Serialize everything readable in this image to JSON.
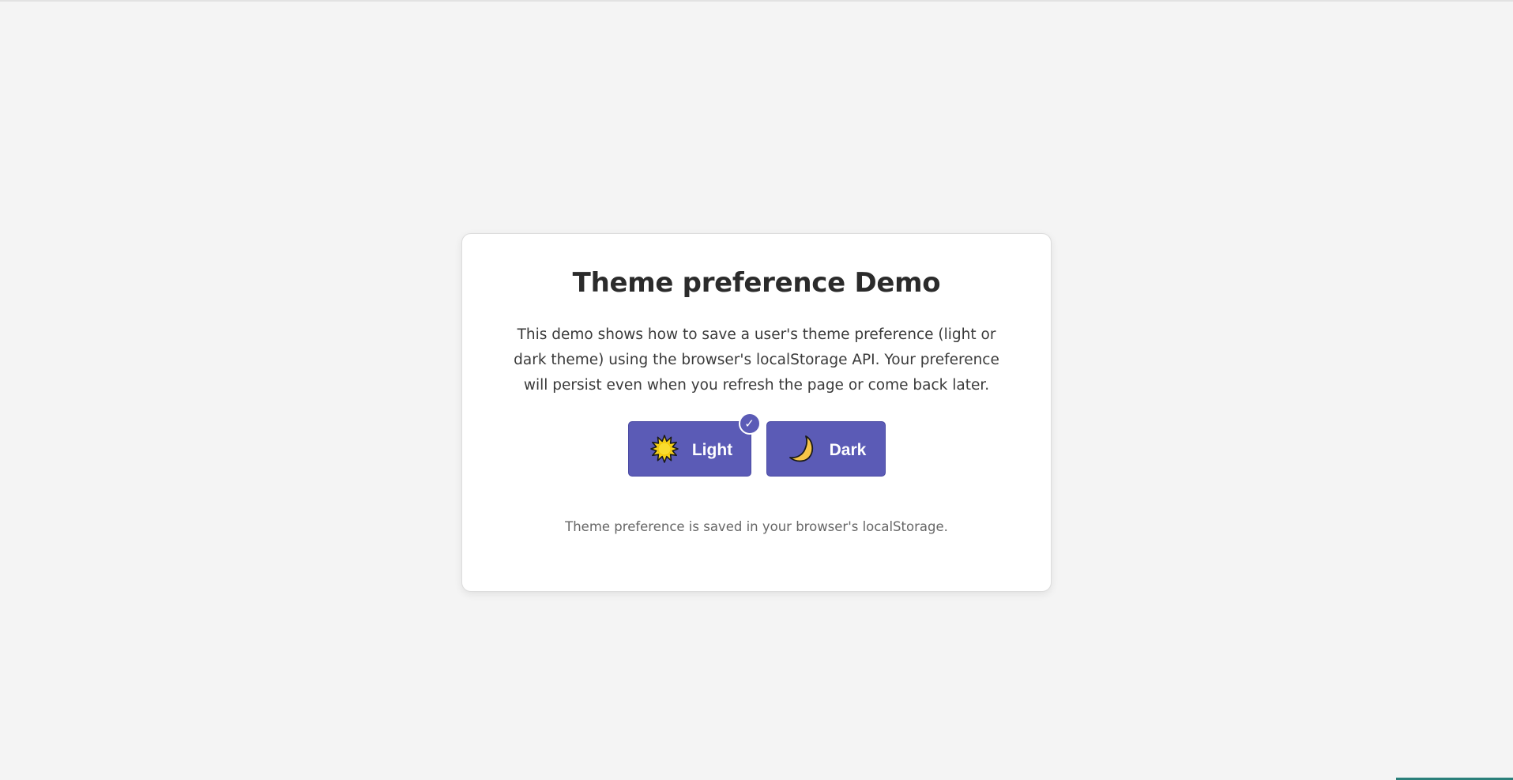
{
  "page": {
    "title": "Theme preference Demo",
    "description": "This demo shows how to save a user's theme preference (light or dark theme) using the browser's localStorage API. Your preference will persist even when you refresh the page or come back later.",
    "footnote": "Theme preference is saved in your browser's localStorage."
  },
  "theme_buttons": [
    {
      "label": "Light",
      "icon": "sun-icon",
      "selected": true
    },
    {
      "label": "Dark",
      "icon": "crescent-moon-icon",
      "selected": false
    }
  ],
  "selected_badge": "✓",
  "colors": {
    "background": "#f4f4f4",
    "card": "#ffffff",
    "button": "#5b5bb6",
    "button_text": "#ffffff",
    "sun": "#f7d21b",
    "moon": "#f6c548"
  }
}
